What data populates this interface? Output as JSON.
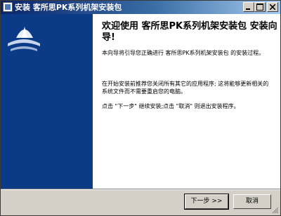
{
  "window": {
    "title": "安装 客所思PK系列机架安装包"
  },
  "content": {
    "heading": "欢迎使用 客所思PK系列机架安装包 安装向导!",
    "paragraph1": "本向导将引导您正确进行 客所思PK系列机架安装包 的安装过程。",
    "paragraph2": "在开始安装前推荐您关闭所有其它的应用程序; 这将能够更新相关的系统文件而不需要重启您的电脑。",
    "paragraph3": "点击 \"下一步\" 继续安装;点击 \"取消\" 则退出安装程序。"
  },
  "buttons": {
    "next_label": "下一步 >>",
    "cancel_label": "取消"
  },
  "colors": {
    "sidebar": "#0b3a86",
    "titlebar_start": "#0a246a",
    "titlebar_end": "#a6caf0"
  }
}
